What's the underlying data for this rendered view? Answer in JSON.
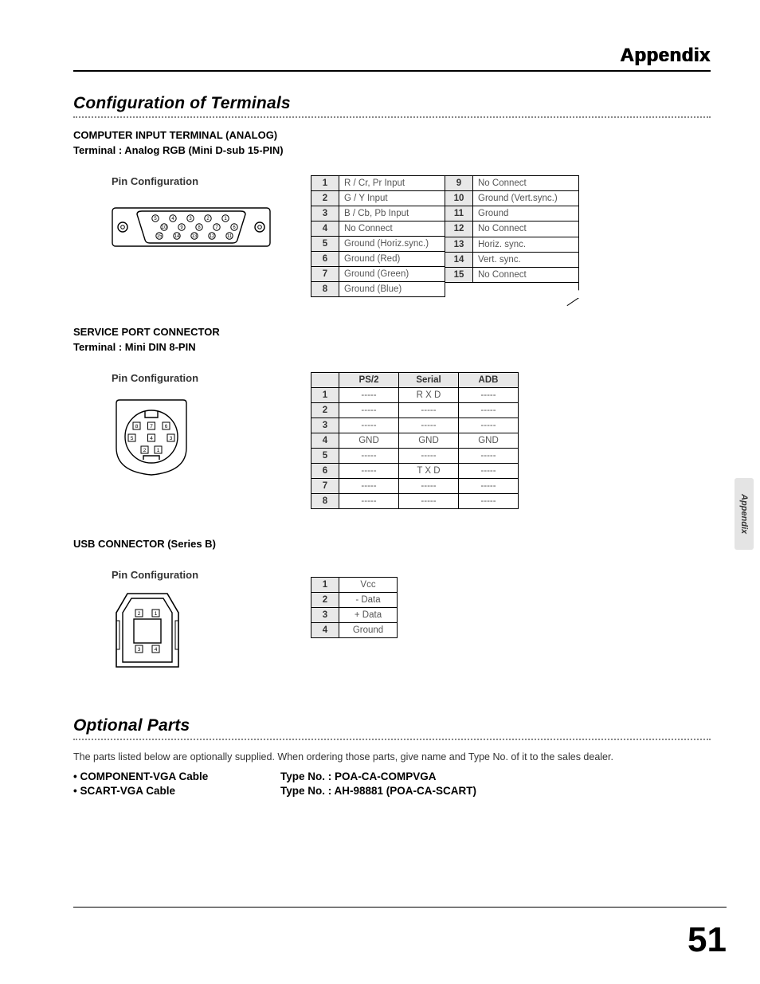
{
  "header": {
    "title": "Appendix"
  },
  "side_tab": "Appendix",
  "page_number": "51",
  "s1": {
    "title": "Configuration of Terminals",
    "h1": "COMPUTER INPUT TERMINAL (ANALOG)",
    "t1": "Terminal : Analog RGB (Mini D-sub 15-PIN)",
    "pin_label": "Pin Configuration",
    "dsub_left": [
      {
        "n": "1",
        "v": "R / Cr, Pr Input"
      },
      {
        "n": "2",
        "v": "G / Y Input"
      },
      {
        "n": "3",
        "v": "B / Cb, Pb Input"
      },
      {
        "n": "4",
        "v": "No Connect"
      },
      {
        "n": "5",
        "v": "Ground (Horiz.sync.)"
      },
      {
        "n": "6",
        "v": "Ground (Red)"
      },
      {
        "n": "7",
        "v": "Ground (Green)"
      },
      {
        "n": "8",
        "v": "Ground (Blue)"
      }
    ],
    "dsub_right": [
      {
        "n": "9",
        "v": "No Connect"
      },
      {
        "n": "10",
        "v": "Ground (Vert.sync.)"
      },
      {
        "n": "11",
        "v": "Ground"
      },
      {
        "n": "12",
        "v": "No Connect"
      },
      {
        "n": "13",
        "v": "Horiz. sync."
      },
      {
        "n": "14",
        "v": "Vert. sync."
      },
      {
        "n": "15",
        "v": "No Connect"
      }
    ]
  },
  "s2": {
    "h1": "SERVICE PORT CONNECTOR",
    "t1": "Terminal : Mini DIN 8-PIN",
    "pin_label": "Pin Configuration",
    "cols": [
      "PS/2",
      "Serial",
      "ADB"
    ],
    "rows": [
      {
        "n": "1",
        "c": [
          "-----",
          "R X D",
          "-----"
        ]
      },
      {
        "n": "2",
        "c": [
          "-----",
          "-----",
          "-----"
        ]
      },
      {
        "n": "3",
        "c": [
          "-----",
          "-----",
          "-----"
        ]
      },
      {
        "n": "4",
        "c": [
          "GND",
          "GND",
          "GND"
        ]
      },
      {
        "n": "5",
        "c": [
          "-----",
          "-----",
          "-----"
        ]
      },
      {
        "n": "6",
        "c": [
          "-----",
          "T X D",
          "-----"
        ]
      },
      {
        "n": "7",
        "c": [
          "-----",
          "-----",
          "-----"
        ]
      },
      {
        "n": "8",
        "c": [
          "-----",
          "-----",
          "-----"
        ]
      }
    ]
  },
  "s3": {
    "h1": "USB CONNECTOR (Series B)",
    "pin_label": "Pin Configuration",
    "rows": [
      {
        "n": "1",
        "v": "Vcc"
      },
      {
        "n": "2",
        "v": "- Data"
      },
      {
        "n": "3",
        "v": "+ Data"
      },
      {
        "n": "4",
        "v": "Ground"
      }
    ]
  },
  "s4": {
    "title": "Optional Parts",
    "intro": "The parts listed below are optionally supplied.  When ordering those parts, give name and Type No. of it to the sales dealer.",
    "items": [
      {
        "name": "• COMPONENT-VGA Cable",
        "type": "Type No.  :  POA-CA-COMPVGA"
      },
      {
        "name": "• SCART-VGA Cable",
        "type": "Type No.  :  AH-98881 (POA-CA-SCART)"
      }
    ]
  }
}
